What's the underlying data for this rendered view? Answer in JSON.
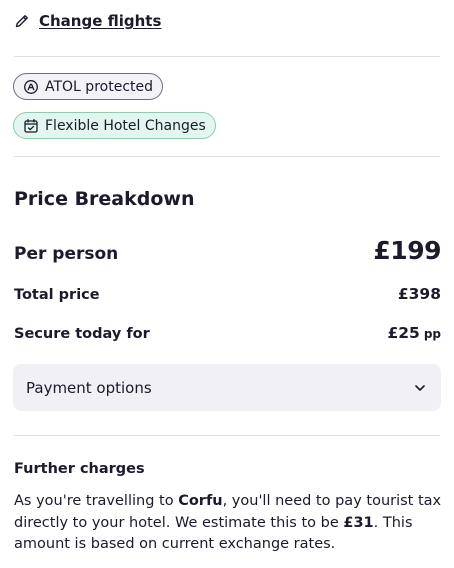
{
  "actions": {
    "change_flights": "Change flights"
  },
  "badges": {
    "atol": "ATOL protected",
    "flexible": "Flexible Hotel Changes"
  },
  "price_breakdown": {
    "title": "Price Breakdown",
    "per_person_label": "Per person",
    "per_person_value": "£199",
    "total_label": "Total price",
    "total_value": "£398",
    "secure_label": "Secure today for",
    "secure_value": "£25",
    "secure_suffix": "pp",
    "payment_options_label": "Payment options"
  },
  "further_charges": {
    "title": "Further charges",
    "text_1": "As you're travelling to ",
    "destination": "Corfu",
    "text_2": ", you'll need to pay tourist tax directly to your hotel. We estimate this to be ",
    "amount": "£31",
    "text_3": ". This amount is based on current exchange rates."
  },
  "icons": {
    "change_flights": "pencil-icon",
    "atol": "atol-shield-icon",
    "flexible": "calendar-check-icon",
    "payment_options": "chevron-down-icon"
  },
  "colors": {
    "text": "#1c1a2b",
    "divider": "#e2e1e8",
    "atol_bg": "#f3f2f7",
    "atol_border": "#6f6c7e",
    "flex_bg": "#e2f5ee",
    "flex_border": "#8fcab5",
    "payment_bg": "#f1f0f5"
  }
}
